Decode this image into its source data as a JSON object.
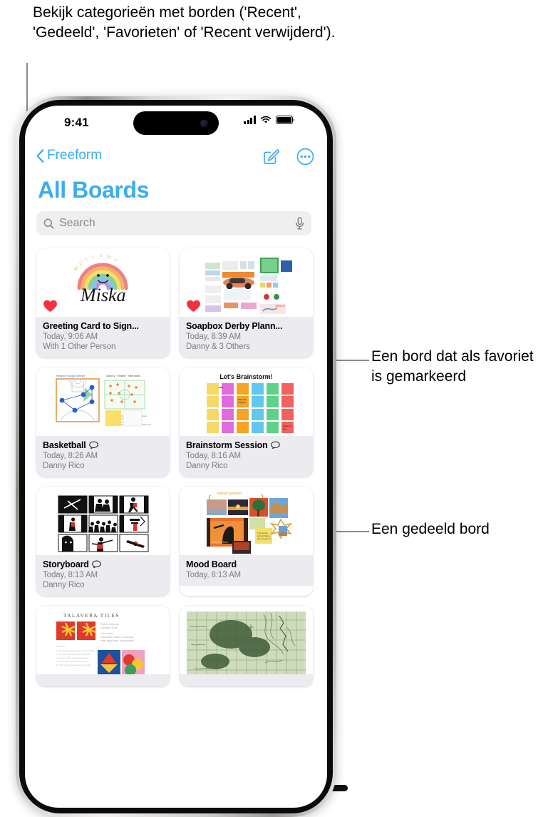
{
  "annotations": {
    "top": "Bekijk categorieën met borden ('Recent', 'Gedeeld', 'Favorieten' of 'Recent verwijderd').",
    "favorite": "Een bord dat als favoriet is gemarkeerd",
    "shared": "Een gedeeld bord"
  },
  "status_bar": {
    "time": "9:41",
    "cellular_icon": "cellular-bars-icon",
    "wifi_icon": "wifi-icon",
    "battery_icon": "battery-full-icon"
  },
  "nav_bar": {
    "back_label": "Freeform",
    "back_icon": "chevron-left-icon",
    "compose_icon": "compose-new-board-icon",
    "more_icon": "more-options-icon"
  },
  "header": {
    "title": "All Boards"
  },
  "search": {
    "placeholder": "Search",
    "search_icon": "search-icon",
    "dictation_icon": "microphone-icon"
  },
  "boards": [
    {
      "title": "Greeting Card to Sign...",
      "time": "Today, 9:06 AM",
      "participants": "With 1 Other Person",
      "favorite": true,
      "shared": false,
      "thumb": "greeting-card-rainbow"
    },
    {
      "title": "Soapbox Derby Plann...",
      "time": "Today, 8:39 AM",
      "participants": "Danny & 3 Others",
      "favorite": true,
      "shared": false,
      "thumb": "soapbox-derby-collage"
    },
    {
      "title": "Basketball",
      "time": "Today, 8:26 AM",
      "participants": "Danny Rico",
      "favorite": false,
      "shared": true,
      "thumb": "basketball-diagram"
    },
    {
      "title": "Brainstorm Session",
      "time": "Today, 8:16 AM",
      "participants": "Danny Rico",
      "favorite": false,
      "shared": true,
      "thumb": "brainstorm-sticky-notes"
    },
    {
      "title": "Storyboard",
      "time": "Today, 8:13 AM",
      "participants": "Danny Rico",
      "favorite": false,
      "shared": true,
      "thumb": "storyboard-sketches"
    },
    {
      "title": "Mood Board",
      "time": "Today, 8:13 AM",
      "participants": "",
      "favorite": false,
      "shared": false,
      "thumb": "mood-board-photos"
    },
    {
      "title": "",
      "time": "",
      "participants": "",
      "favorite": false,
      "shared": false,
      "thumb": "talavera-tiles"
    },
    {
      "title": "",
      "time": "",
      "participants": "",
      "favorite": false,
      "shared": false,
      "thumb": "topographic-map"
    }
  ],
  "thumb_text": {
    "brainstorm_heading": "Let's Brainstorm!",
    "talavera_heading": "TALAVERA TILES",
    "greeting_word": "Welcome",
    "greeting_name": "Miska",
    "mood_heading": "Sunset palettes"
  },
  "colors": {
    "accent": "#3badf0",
    "favorite_heart": "#f2313f",
    "card_footer": "#ecebef",
    "search_field": "#efeff0",
    "secondary_text": "#7d7d82"
  }
}
